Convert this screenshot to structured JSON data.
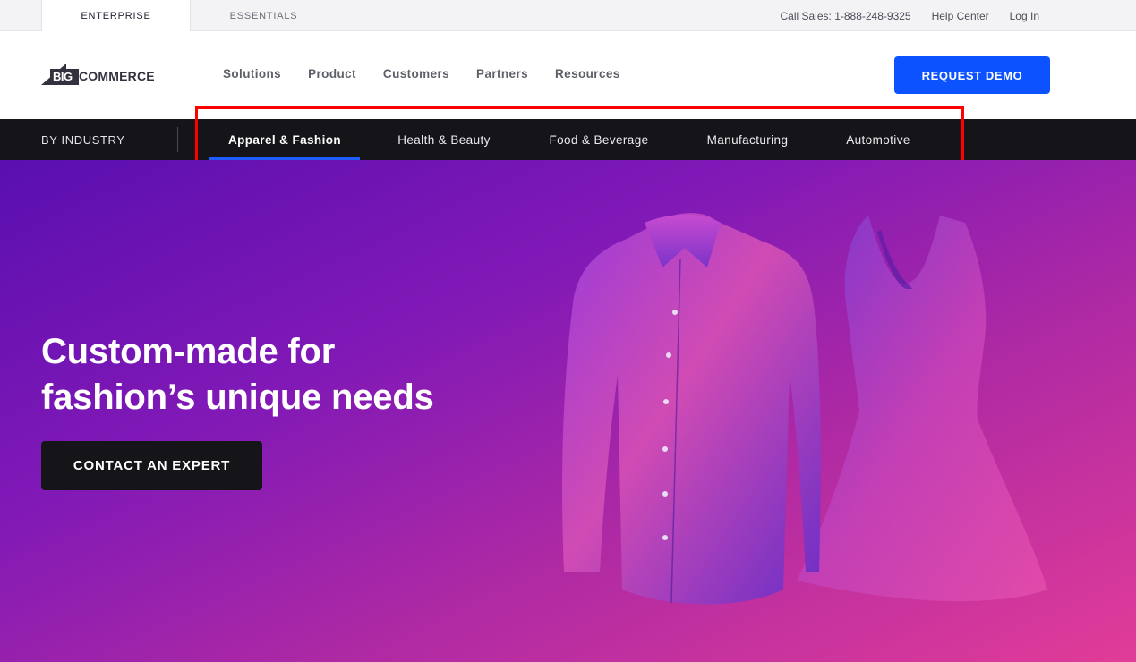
{
  "utility": {
    "tabs": [
      {
        "label": "ENTERPRISE",
        "active": true
      },
      {
        "label": "ESSENTIALS",
        "active": false
      }
    ],
    "call_sales": "Call Sales: 1-888-248-9325",
    "help_center": "Help Center",
    "log_in": "Log In"
  },
  "header": {
    "logo_big": "BIG",
    "logo_commerce": "COMMERCE",
    "nav": [
      "Solutions",
      "Product",
      "Customers",
      "Partners",
      "Resources"
    ],
    "request_demo": "REQUEST DEMO"
  },
  "industry": {
    "label": "BY INDUSTRY",
    "tabs": [
      {
        "label": "Apparel & Fashion",
        "active": true
      },
      {
        "label": "Health & Beauty",
        "active": false
      },
      {
        "label": "Food & Beverage",
        "active": false
      },
      {
        "label": "Manufacturing",
        "active": false
      },
      {
        "label": "Automotive",
        "active": false
      }
    ]
  },
  "hero": {
    "title_line1": "Custom-made for",
    "title_line2": "fashion’s unique needs",
    "cta": "CONTACT AN EXPERT"
  },
  "colors": {
    "accent_blue": "#0d52ff",
    "dark_bar": "#151519",
    "hero_gradient_start": "#5a0fb0",
    "hero_gradient_end": "#e13c98",
    "highlight": "#ff0000"
  },
  "icons": {
    "logo": "bigcommerce-logo-mark",
    "hero_image": "shirt-and-dress-illustration"
  }
}
